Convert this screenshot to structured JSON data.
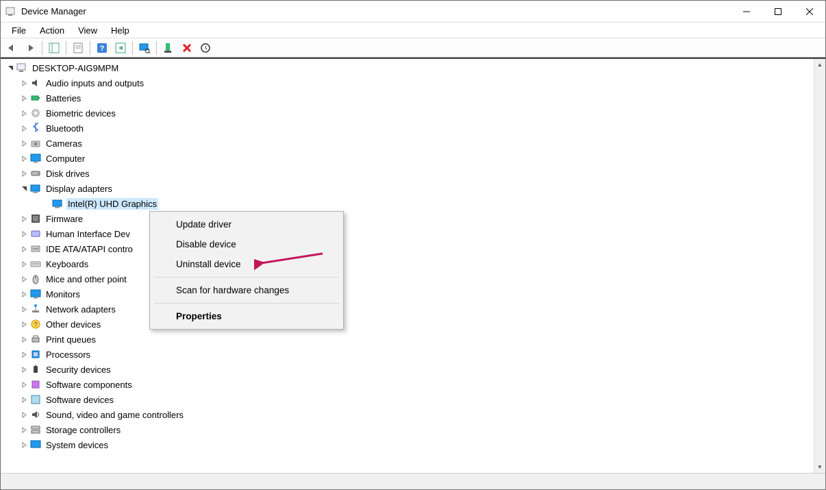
{
  "window": {
    "title": "Device Manager"
  },
  "menubar": [
    "File",
    "Action",
    "View",
    "Help"
  ],
  "toolbar": [
    {
      "id": "back",
      "name": "back-icon"
    },
    {
      "id": "fwd",
      "name": "forward-icon"
    },
    {
      "id": "sep"
    },
    {
      "id": "showhide",
      "name": "show-hide-tree-icon"
    },
    {
      "id": "sep"
    },
    {
      "id": "props-sheet",
      "name": "properties-sheet-icon"
    },
    {
      "id": "sep"
    },
    {
      "id": "help",
      "name": "help-icon"
    },
    {
      "id": "action",
      "name": "action-icon"
    },
    {
      "id": "sep"
    },
    {
      "id": "scan",
      "name": "scan-hardware-icon"
    },
    {
      "id": "sep"
    },
    {
      "id": "add-legacy",
      "name": "add-legacy-icon"
    },
    {
      "id": "uninstall",
      "name": "uninstall-icon"
    },
    {
      "id": "cycle",
      "name": "cycle-icon"
    }
  ],
  "tree": {
    "root": {
      "label": "DESKTOP-AIG9MPM",
      "expanded": true,
      "icon": "computer-icon"
    },
    "nodes": [
      {
        "label": "Audio inputs and outputs",
        "expanded": false,
        "icon": "audio-icon"
      },
      {
        "label": "Batteries",
        "expanded": false,
        "icon": "battery-icon"
      },
      {
        "label": "Biometric devices",
        "expanded": false,
        "icon": "fingerprint-icon"
      },
      {
        "label": "Bluetooth",
        "expanded": false,
        "icon": "bluetooth-icon"
      },
      {
        "label": "Cameras",
        "expanded": false,
        "icon": "camera-icon"
      },
      {
        "label": "Computer",
        "expanded": false,
        "icon": "monitor-icon"
      },
      {
        "label": "Disk drives",
        "expanded": false,
        "icon": "disk-icon"
      },
      {
        "label": "Display adapters",
        "expanded": true,
        "icon": "display-adapter-icon",
        "children": [
          {
            "label": "Intel(R) UHD Graphics",
            "icon": "display-adapter-icon",
            "selected": true
          }
        ]
      },
      {
        "label": "Firmware",
        "expanded": false,
        "icon": "firmware-icon"
      },
      {
        "label": "Human Interface Dev",
        "expanded": false,
        "icon": "hid-icon",
        "truncated": true
      },
      {
        "label": "IDE ATA/ATAPI contro",
        "expanded": false,
        "icon": "ide-icon",
        "truncated": true
      },
      {
        "label": "Keyboards",
        "expanded": false,
        "icon": "keyboard-icon"
      },
      {
        "label": "Mice and other point",
        "expanded": false,
        "icon": "mouse-icon",
        "truncated": true
      },
      {
        "label": "Monitors",
        "expanded": false,
        "icon": "monitor-icon"
      },
      {
        "label": "Network adapters",
        "expanded": false,
        "icon": "network-icon"
      },
      {
        "label": "Other devices",
        "expanded": false,
        "icon": "other-device-icon"
      },
      {
        "label": "Print queues",
        "expanded": false,
        "icon": "printer-icon"
      },
      {
        "label": "Processors",
        "expanded": false,
        "icon": "cpu-icon"
      },
      {
        "label": "Security devices",
        "expanded": false,
        "icon": "security-icon"
      },
      {
        "label": "Software components",
        "expanded": false,
        "icon": "software-component-icon"
      },
      {
        "label": "Software devices",
        "expanded": false,
        "icon": "software-device-icon"
      },
      {
        "label": "Sound, video and game controllers",
        "expanded": false,
        "icon": "sound-icon"
      },
      {
        "label": "Storage controllers",
        "expanded": false,
        "icon": "storage-icon"
      },
      {
        "label": "System devices",
        "expanded": false,
        "icon": "system-icon",
        "truncated": true
      }
    ]
  },
  "context_menu": {
    "items": [
      {
        "label": "Update driver",
        "kind": "item"
      },
      {
        "label": "Disable device",
        "kind": "item"
      },
      {
        "label": "Uninstall device",
        "kind": "item",
        "highlighted": true
      },
      {
        "kind": "sep"
      },
      {
        "label": "Scan for hardware changes",
        "kind": "item"
      },
      {
        "kind": "sep"
      },
      {
        "label": "Properties",
        "kind": "item",
        "default": true
      }
    ]
  }
}
